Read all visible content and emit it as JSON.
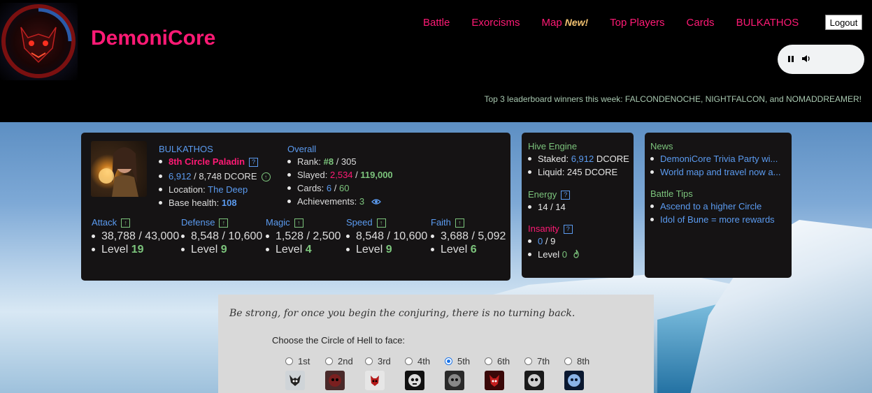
{
  "site": {
    "title": "DemoniCore"
  },
  "nav": {
    "items": [
      "Battle",
      "Exorcisms",
      "Map",
      "Top Players",
      "Cards",
      "BULKATHOS"
    ],
    "map_badge": "New!",
    "logout": "Logout"
  },
  "ticker": "Top 3 leaderboard winners this week: FALCONDENOCHE, NIGHTFALCON, and NOMADDREAMER!",
  "player": {
    "name": "BULKATHOS",
    "title": "8th Circle Paladin",
    "dcore_have": "6,912",
    "dcore_total": "/ 8,748 DCORE",
    "location_label": "Location:",
    "location": "The Deep",
    "base_health_label": "Base health:",
    "base_health": "108"
  },
  "overall": {
    "heading": "Overall",
    "rank_label": "Rank:",
    "rank": "#8",
    "rank_total": "/ 305",
    "slayed_label": "Slayed:",
    "slayed": "2,534",
    "slayed_total": "119,000",
    "cards_label": "Cards:",
    "cards": "6",
    "cards_total": "60",
    "achievements_label": "Achievements:",
    "achievements": "3"
  },
  "stats": [
    {
      "name": "Attack",
      "value": "38,788 / 43,000",
      "level_label": "Level",
      "level": "19"
    },
    {
      "name": "Defense",
      "value": "8,548 / 10,600",
      "level_label": "Level",
      "level": "9"
    },
    {
      "name": "Magic",
      "value": "1,528 / 2,500",
      "level_label": "Level",
      "level": "4"
    },
    {
      "name": "Speed",
      "value": "8,548 / 10,600",
      "level_label": "Level",
      "level": "9"
    },
    {
      "name": "Faith",
      "value": "3,688 / 5,092",
      "level_label": "Level",
      "level": "6"
    }
  ],
  "hive": {
    "heading": "Hive Engine",
    "staked_label": "Staked:",
    "staked": "6,912",
    "staked_unit": "DCORE",
    "liquid": "Liquid: 245 DCORE",
    "energy_heading": "Energy",
    "energy": "14 / 14",
    "insanity_heading": "Insanity",
    "insanity": "0",
    "insanity_total": "/ 9",
    "insanity_level_label": "Level",
    "insanity_level": "0"
  },
  "news": {
    "heading": "News",
    "items": [
      "DemoniCore Trivia Party wi...",
      "World map and travel now a..."
    ],
    "tips_heading": "Battle Tips",
    "tips": [
      "Ascend to a higher Circle",
      "Idol of Bune = more rewards"
    ]
  },
  "conjure": {
    "quote": "Be strong, for once you begin the conjuring, there is no turning back.",
    "prompt": "Choose the Circle of Hell to face:",
    "circles": [
      "1st",
      "2nd",
      "3rd",
      "4th",
      "5th",
      "6th",
      "7th",
      "8th"
    ],
    "selected": "5th"
  },
  "colors": {
    "accent": "#ff1a75",
    "link": "#5b9bf0",
    "good": "#7cc47c"
  },
  "icons": [
    "pause-icon",
    "volume-icon",
    "upgrade-arrow-icon",
    "help-icon",
    "eye-icon",
    "flame-icon"
  ]
}
